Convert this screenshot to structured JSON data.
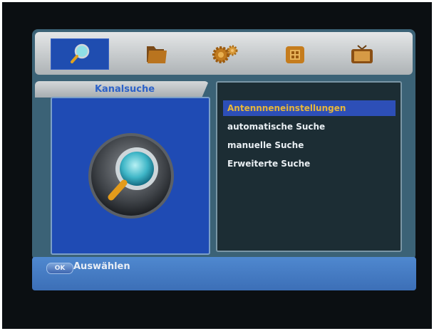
{
  "menu_title": "Kanalsuche",
  "categories": [
    {
      "name": "search-icon",
      "selected": true
    },
    {
      "name": "folder-icon",
      "selected": false
    },
    {
      "name": "gears-icon",
      "selected": false
    },
    {
      "name": "box-icon",
      "selected": false
    },
    {
      "name": "tv-icon",
      "selected": false
    }
  ],
  "menu_items": [
    {
      "label": "Antennneneinstellungen",
      "selected": true
    },
    {
      "label": "automatische Suche",
      "selected": false
    },
    {
      "label": "manuelle Suche",
      "selected": false
    },
    {
      "label": "Erweiterte Suche",
      "selected": false
    }
  ],
  "help": {
    "button": "OK",
    "text": "Auswählen"
  },
  "colors": {
    "highlight": "#2d4fb7",
    "highlight_text": "#e7b73a",
    "panel": "#1f4bb4",
    "frame": "#3b6276"
  }
}
